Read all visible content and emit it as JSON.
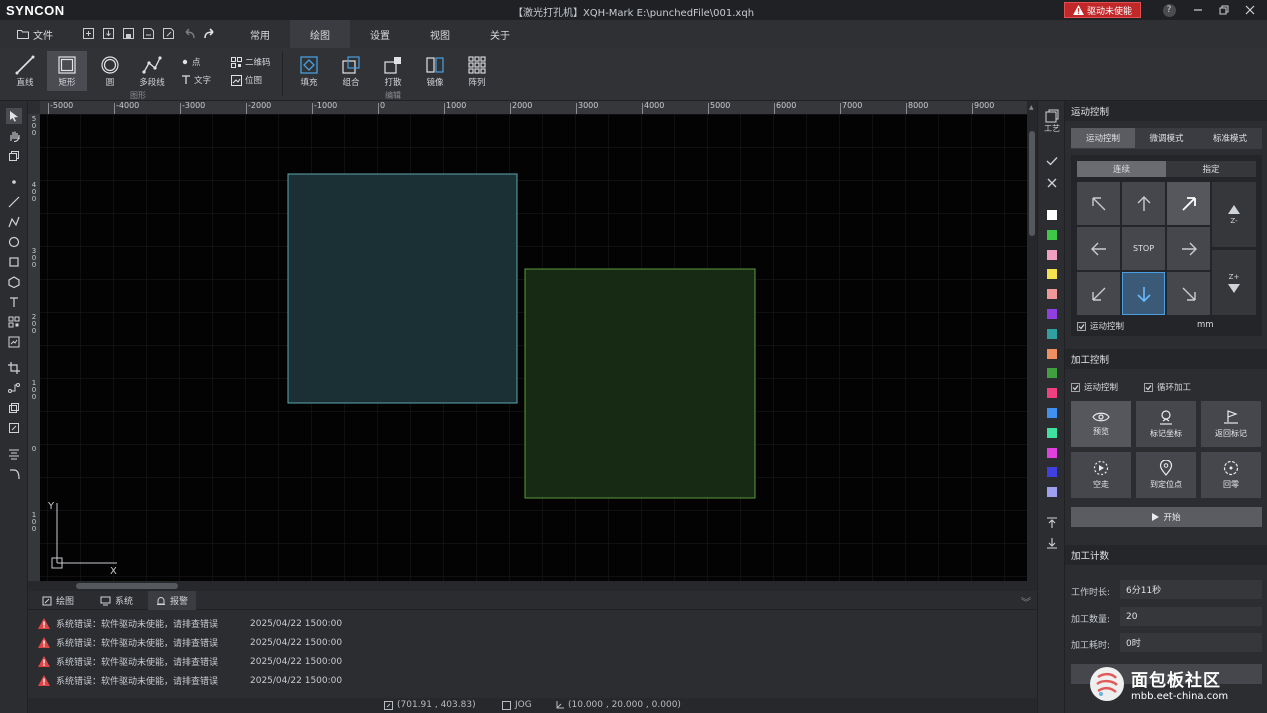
{
  "app": {
    "logo": "SYNCON",
    "title": "【激光打孔机】XQH-Mark  E:\\punchedFile\\001.xqh",
    "alert_label": "驱动未使能",
    "help": "?"
  },
  "menu": {
    "file": "文件",
    "tabs": [
      "常用",
      "绘图",
      "设置",
      "视图",
      "关于"
    ],
    "active_tab": "绘图"
  },
  "toolbar": {
    "shapes": {
      "line": "直线",
      "rect": "矩形",
      "circle": "圆",
      "polyline": "多段线",
      "point": "点",
      "text": "文字",
      "qrcode": "二维码",
      "bitmap": "位图",
      "group_label": "图形"
    },
    "edit": {
      "fill": "填充",
      "combine": "组合",
      "explode": "打散",
      "mirror": "镜像",
      "array": "阵列",
      "group_label": "编辑"
    }
  },
  "ruler": {
    "top_ticks": [
      "-5000",
      "-4000",
      "-3000",
      "-2000",
      "-1000",
      "0",
      "1000",
      "2000",
      "3000",
      "4000",
      "5000",
      "6000",
      "7000",
      "8000",
      "9000"
    ],
    "left_ticks": [
      "500",
      "400",
      "300",
      "200",
      "100",
      "0",
      "100"
    ]
  },
  "canvas": {
    "axis_x": "X",
    "axis_y": "Y",
    "colors": {
      "rect1_stroke": "#5fa8b0",
      "rect1_fill": "#1a3034",
      "rect2_stroke": "#5a9a3a",
      "rect2_fill": "#172a14"
    }
  },
  "bottom_tabs": [
    "绘图",
    "系统",
    "报警"
  ],
  "log": [
    {
      "message": "系统错误：软件驱动未使能，请排查错误",
      "time": "2025/04/22 1500:00"
    },
    {
      "message": "系统错误：软件驱动未使能，请排查错误",
      "time": "2025/04/22 1500:00"
    },
    {
      "message": "系统错误：软件驱动未使能，请排查错误",
      "time": "2025/04/22 1500:00"
    },
    {
      "message": "系统错误：软件驱动未使能，请排查错误",
      "time": "2025/04/22 1500:00"
    }
  ],
  "status": {
    "cursor": "(701.91 , 403.83)",
    "jog": "JOG",
    "position": "(10.000 , 20.000 , 0.000)"
  },
  "side_strip": {
    "craft_label": "工艺",
    "swatches": [
      "#ffffff",
      "#3ec84a",
      "#f0a0c0",
      "#f5e050",
      "#f09898",
      "#9040e0",
      "#30a0a0",
      "#f09060",
      "#40a040",
      "#f04080",
      "#4090f0",
      "#40e0a0",
      "#e040e0",
      "#4040e0",
      "#a0a0f0"
    ]
  },
  "motion": {
    "header": "运动控制",
    "modes": [
      "运动控制",
      "微调模式",
      "标准模式"
    ],
    "submodes": [
      "连续",
      "指定"
    ],
    "stop": "STOP",
    "z_minus": "Z-",
    "z_plus": "Z+",
    "enable_label": "运动控制",
    "unit": "mm"
  },
  "process": {
    "header": "加工控制",
    "checks": [
      "运动控制",
      "循环加工"
    ],
    "buttons": [
      "预览",
      "标记坐标",
      "返回标记",
      "空走",
      "到定位点",
      "回零"
    ],
    "start": "开始"
  },
  "counter": {
    "header": "加工计数",
    "work_time_label": "工作时长:",
    "work_time": "6分11秒",
    "count_label": "加工数量:",
    "count": "20",
    "duration_label": "加工耗时:",
    "duration": "0时"
  },
  "watermark": {
    "site": "面包板社区",
    "url": "mbb.eet-china.com"
  }
}
